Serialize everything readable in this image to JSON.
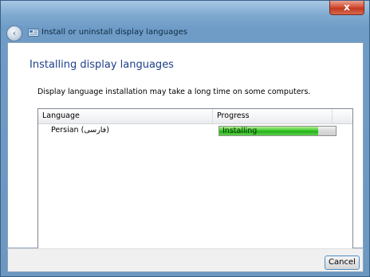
{
  "window": {
    "title": "Install or uninstall display languages",
    "close_label": "x",
    "back_label": "‹"
  },
  "main": {
    "heading": "Installing display languages",
    "info": "Display language installation may take a long time on some computers."
  },
  "table": {
    "columns": [
      "Language",
      "Progress"
    ],
    "rows": [
      {
        "language": "Persian (فارسی)",
        "status": "Installing",
        "progress_fraction": 0.85
      }
    ]
  },
  "footer": {
    "cancel_label": "Cancel"
  },
  "colors": {
    "heading": "#1e3f8a",
    "progress_green": "#3fcb2b",
    "titlebar_blue": "#6f9cc6"
  }
}
